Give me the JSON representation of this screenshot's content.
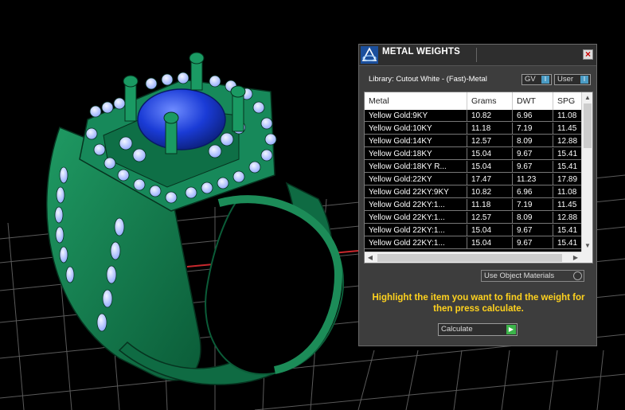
{
  "dialog": {
    "title": "METAL WEIGHTS",
    "library_label": "Library: Cutout White - (Fast)-Metal",
    "gv_label": "GV",
    "user_label": "User",
    "columns": [
      "Metal",
      "Grams",
      "DWT",
      "SPG"
    ],
    "rows": [
      [
        "Yellow Gold:9KY",
        "10.82",
        "6.96",
        "11.08"
      ],
      [
        "Yellow Gold:10KY",
        "11.18",
        "7.19",
        "11.45"
      ],
      [
        "Yellow Gold:14KY",
        "12.57",
        "8.09",
        "12.88"
      ],
      [
        "Yellow Gold:18KY",
        "15.04",
        "9.67",
        "15.41"
      ],
      [
        "Yellow Gold:18KY R...",
        "15.04",
        "9.67",
        "15.41"
      ],
      [
        "Yellow Gold:22KY",
        "17.47",
        "11.23",
        "17.89"
      ],
      [
        "Yellow Gold 22KY:9KY",
        "10.82",
        "6.96",
        "11.08"
      ],
      [
        "Yellow Gold 22KY:1...",
        "11.18",
        "7.19",
        "11.45"
      ],
      [
        "Yellow Gold 22KY:1...",
        "12.57",
        "8.09",
        "12.88"
      ],
      [
        "Yellow Gold 22KY:1...",
        "15.04",
        "9.67",
        "15.41"
      ],
      [
        "Yellow Gold 22KY:1...",
        "15.04",
        "9.67",
        "15.41"
      ]
    ],
    "use_object_materials": "Use Object Materials",
    "hint": "Highlight the item you want to find the weight for then press calculate.",
    "calculate_label": "Calculate"
  },
  "colors": {
    "ring": "#127a4e",
    "gem": "#1a3bd6",
    "grid": "#5a5a5a",
    "hint": "#ffd21e",
    "accent": "#4a9bc4"
  },
  "icons": [
    "app-logo-icon",
    "close-icon",
    "scroll-up-icon",
    "scroll-down-icon",
    "scroll-left-icon",
    "scroll-right-icon",
    "play-icon"
  ]
}
